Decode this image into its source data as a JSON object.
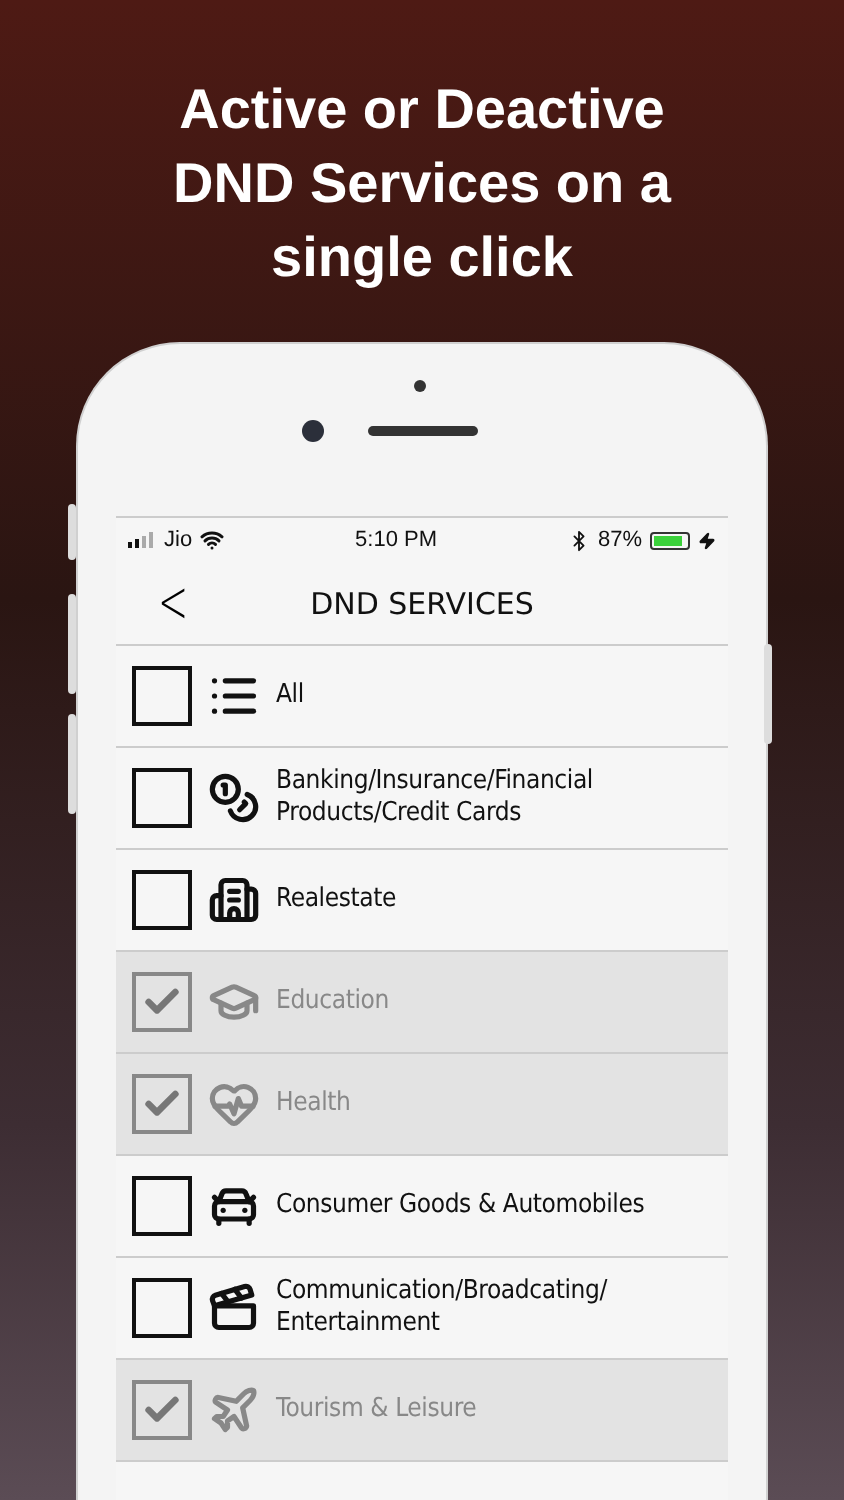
{
  "headline": "Active or Deactive DND Services on a single click",
  "status_bar": {
    "carrier": "Jio",
    "time": "5:10 PM",
    "battery": "87%"
  },
  "nav": {
    "back": "<",
    "title": "DND SERVICES"
  },
  "services": [
    {
      "label": "All",
      "checked": false
    },
    {
      "label": "Banking/Insurance/Financial Products/Credit Cards",
      "checked": false
    },
    {
      "label": "Realestate",
      "checked": false
    },
    {
      "label": "Education",
      "checked": true
    },
    {
      "label": "Health",
      "checked": true
    },
    {
      "label": "Consumer Goods & Automobiles",
      "checked": false
    },
    {
      "label": "Communication/Broadcating/ Entertainment",
      "checked": false
    },
    {
      "label": "Tourism & Leisure",
      "checked": true
    }
  ]
}
